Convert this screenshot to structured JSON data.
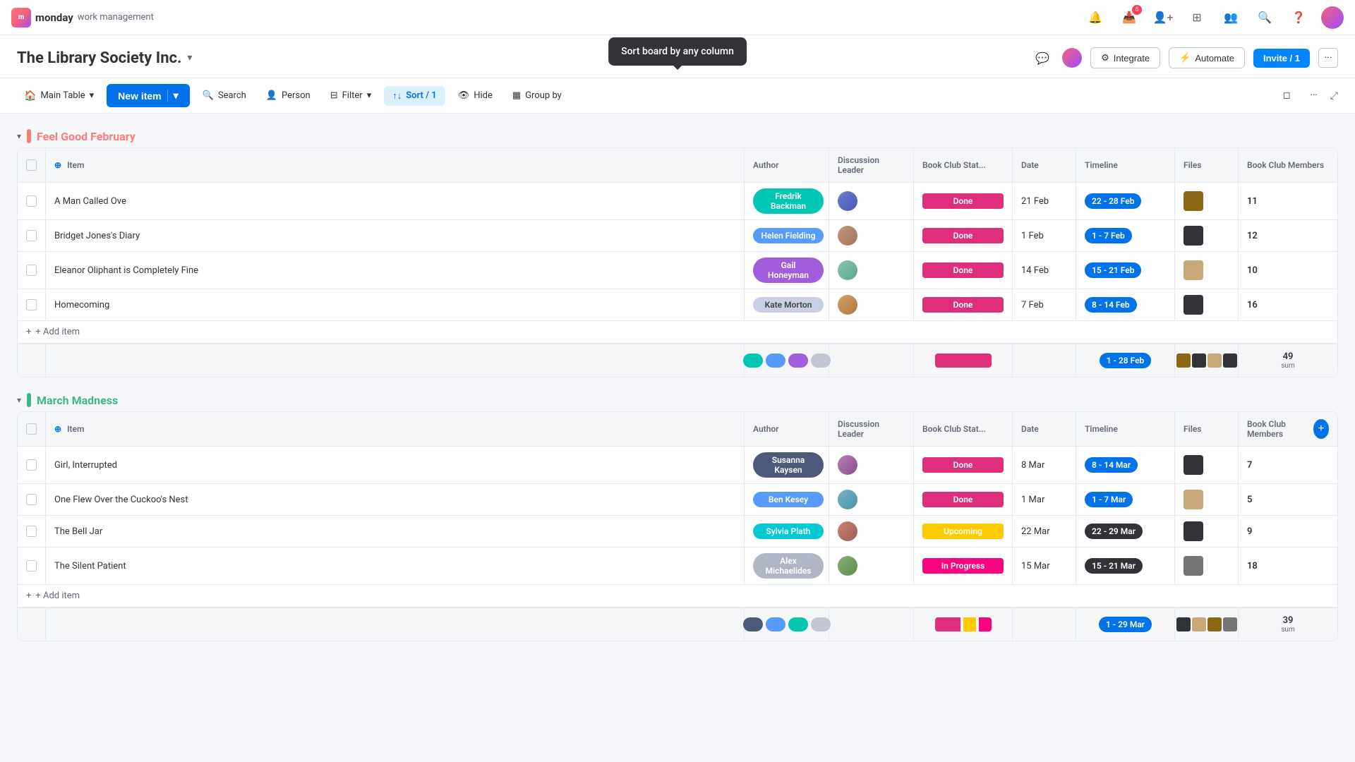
{
  "app": {
    "name": "monday",
    "subtitle": "work management"
  },
  "topnav": {
    "notification_count": "6",
    "invite_label": "Invite / 1",
    "more_label": "..."
  },
  "workspace": {
    "title": "The Library Society Inc.",
    "integrate_label": "Integrate",
    "automate_label": "Automate",
    "invite_label": "Invite / 1"
  },
  "toolbar": {
    "table_name": "Main Table",
    "new_item_label": "New item",
    "search_label": "Search",
    "person_label": "Person",
    "filter_label": "Filter",
    "sort_label": "Sort / 1",
    "hide_label": "Hide",
    "group_by_label": "Group by",
    "sort_tooltip": "Sort board by any column"
  },
  "groups": [
    {
      "id": "feel_good",
      "title": "Feel Good February",
      "color": "#ff7b7b",
      "columns": [
        "Item",
        "Author",
        "Discussion Leader",
        "Book Club Stat...",
        "Date",
        "Timeline",
        "Files",
        "Book Club Members"
      ],
      "rows": [
        {
          "item": "A Man Called Ove",
          "author": "Fredrik Backman",
          "author_color": "teal",
          "disc_avatar": "avatar-1",
          "status": "Done",
          "status_type": "done",
          "date": "21 Feb",
          "timeline": "22 - 28 Feb",
          "members": "11"
        },
        {
          "item": "Bridget Jones's Diary",
          "author": "Helen Fielding",
          "author_color": "blue",
          "disc_avatar": "avatar-2",
          "status": "Done",
          "status_type": "done",
          "date": "1 Feb",
          "timeline": "1 - 7 Feb",
          "members": "12"
        },
        {
          "item": "Eleanor Oliphant is Completely Fine",
          "author": "Gail Honeyman",
          "author_color": "purple",
          "disc_avatar": "avatar-3",
          "status": "Done",
          "status_type": "done",
          "date": "14 Feb",
          "timeline": "15 - 21 Feb",
          "members": "10"
        },
        {
          "item": "Homecoming",
          "author": "Kate Morton",
          "author_color": "light",
          "disc_avatar": "avatar-4",
          "status": "Done",
          "status_type": "done",
          "date": "7 Feb",
          "timeline": "8 - 14 Feb",
          "members": "16"
        }
      ],
      "summary_timeline": "1 - 28 Feb",
      "summary_members": "49",
      "add_item_label": "+ Add item"
    },
    {
      "id": "march_madness",
      "title": "March Madness",
      "color": "#3db88b",
      "columns": [
        "Item",
        "Author",
        "Discussion Leader",
        "Book Club Stat...",
        "Date",
        "Timeline",
        "Files",
        "Book Club Members"
      ],
      "rows": [
        {
          "item": "Girl, Interrupted",
          "author": "Susanna Kaysen",
          "author_color": "dark",
          "disc_avatar": "avatar-5",
          "status": "Done",
          "status_type": "done",
          "date": "8 Mar",
          "timeline": "8 - 14 Mar",
          "members": "7"
        },
        {
          "item": "One Flew Over the Cuckoo's Nest",
          "author": "Ben Kesey",
          "author_color": "blue2",
          "disc_avatar": "avatar-6",
          "status": "Done",
          "status_type": "done",
          "date": "1 Mar",
          "timeline": "1 - 7 Mar",
          "members": "5"
        },
        {
          "item": "The Bell Jar",
          "author": "Sylvia Plath",
          "author_color": "teal2",
          "disc_avatar": "avatar-7",
          "status": "Upcoming",
          "status_type": "upcoming",
          "date": "22 Mar",
          "timeline": "22 - 29 Mar",
          "members": "9"
        },
        {
          "item": "The Silent Patient",
          "author": "Alex Michaelides",
          "author_color": "gray",
          "disc_avatar": "avatar-8",
          "status": "In Progress",
          "status_type": "inprogress",
          "date": "15 Mar",
          "timeline": "15 - 21 Mar",
          "members": "18"
        }
      ],
      "summary_timeline": "1 - 29 Mar",
      "summary_members": "39",
      "add_item_label": "+ Add item"
    }
  ]
}
